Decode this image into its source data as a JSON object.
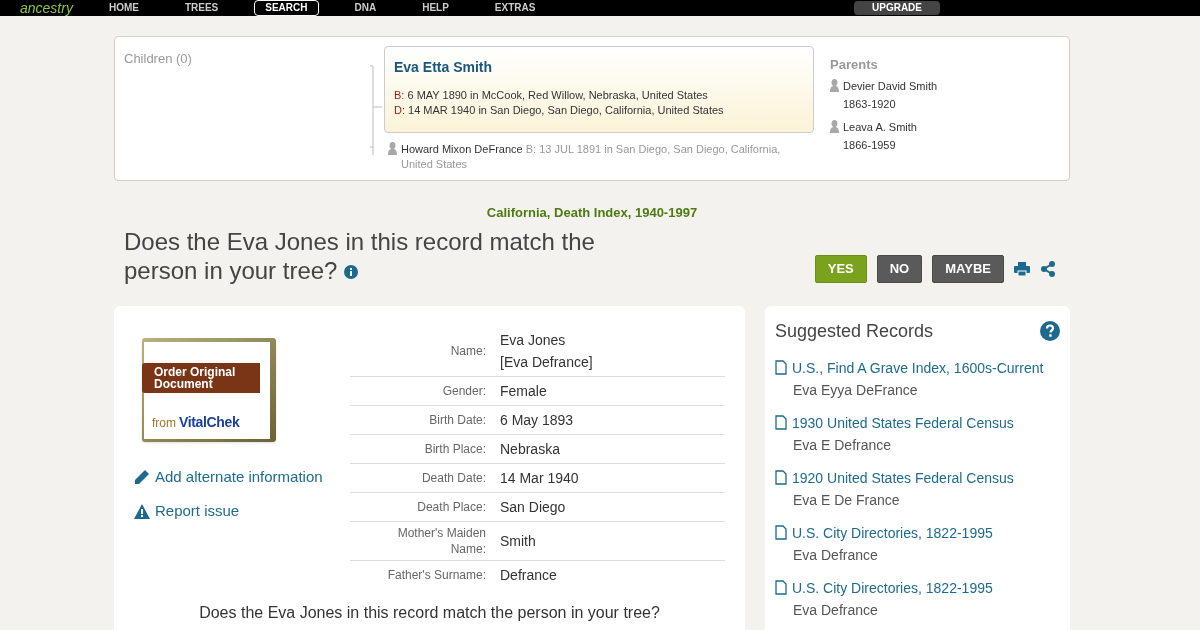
{
  "nav": {
    "logo": "ancestry",
    "items": [
      {
        "label": "HOME",
        "selected": false
      },
      {
        "label": "TREES",
        "selected": false
      },
      {
        "label": "SEARCH",
        "selected": true
      },
      {
        "label": "DNA",
        "selected": false
      },
      {
        "label": "HELP",
        "selected": false
      },
      {
        "label": "EXTRAS",
        "selected": false
      }
    ],
    "upgrade": "UPGRADE"
  },
  "family": {
    "children_label": "Children (0)",
    "person": {
      "name": "Eva Etta Smith",
      "birth_label": "B:",
      "birth": "6 MAY 1890 in McCook, Red Willow, Nebraska, United States",
      "death_label": "D:",
      "death": "14 MAR 1940 in San Diego, San Diego, California, United States"
    },
    "spouse": {
      "name": "Howard Mixon DeFrance",
      "birth_label": "B:",
      "birth": "13 JUL 1891 in San Diego, San Diego, California, United States"
    },
    "parents_label": "Parents",
    "parents": [
      {
        "name": "Devier David Smith",
        "years": "1863-1920"
      },
      {
        "name": "Leava A. Smith",
        "years": "1866-1959"
      }
    ]
  },
  "collection": "California, Death Index, 1940-1997",
  "question": "Does the Eva Jones in this record match the person in your tree?",
  "answers": [
    {
      "label": "YES",
      "kind": "yes"
    },
    {
      "label": "NO",
      "kind": "no"
    },
    {
      "label": "MAYBE",
      "kind": "maybe"
    }
  ],
  "order": {
    "line1": "Order Original",
    "line2": "Document",
    "from": "from",
    "brand": "VitalChek"
  },
  "actions": [
    {
      "label": "Add alternate information",
      "kind": "edit"
    },
    {
      "label": "Report issue",
      "kind": "warning"
    }
  ],
  "fields": [
    {
      "label": "Name:",
      "values": [
        "Eva Jones",
        "[Eva Defrance]"
      ]
    },
    {
      "label": "Gender:",
      "values": [
        "Female"
      ]
    },
    {
      "label": "Birth Date:",
      "values": [
        "6 May 1893"
      ]
    },
    {
      "label": "Birth Place:",
      "values": [
        "Nebraska"
      ]
    },
    {
      "label": "Death Date:",
      "values": [
        "14 Mar 1940"
      ]
    },
    {
      "label": "Death Place:",
      "values": [
        "San Diego"
      ]
    },
    {
      "label": "Mother's Maiden Name:",
      "values": [
        "Smith"
      ]
    },
    {
      "label": "Father's Surname:",
      "values": [
        "Defrance"
      ]
    }
  ],
  "bottom_question": "Does the Eva Jones in this record match the person in your tree?",
  "suggested": {
    "title": "Suggested Records",
    "records": [
      {
        "title": "U.S., Find A Grave Index, 1600s-Current",
        "person": "Eva Eyya DeFrance"
      },
      {
        "title": "1930 United States Federal Census",
        "person": "Eva E Defrance"
      },
      {
        "title": "1920 United States Federal Census",
        "person": "Eva E De France"
      },
      {
        "title": "U.S. City Directories, 1822-1995",
        "person": "Eva Defrance"
      },
      {
        "title": "U.S. City Directories, 1822-1995",
        "person": "Eva Defrance"
      }
    ]
  }
}
